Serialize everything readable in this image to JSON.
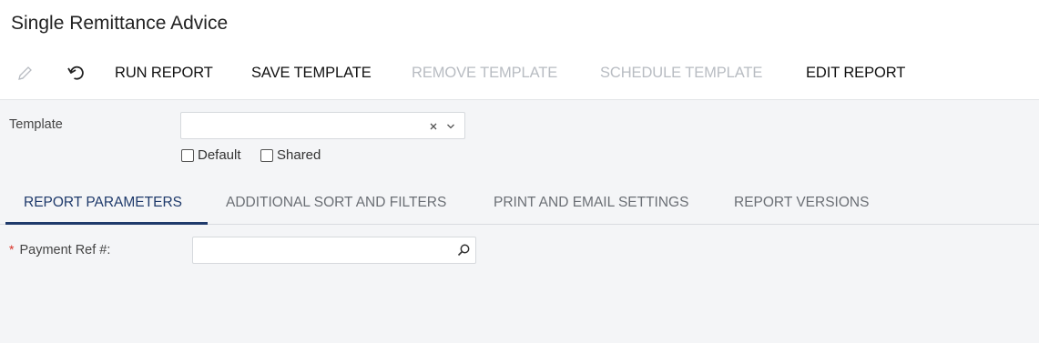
{
  "page": {
    "title": "Single Remittance Advice"
  },
  "toolbar": {
    "run_report": "RUN REPORT",
    "save_template": "SAVE TEMPLATE",
    "remove_template": "REMOVE TEMPLATE",
    "schedule_template": "SCHEDULE TEMPLATE",
    "edit_report": "EDIT REPORT",
    "icons": {
      "edit": "pencil-icon",
      "undo": "undo-icon"
    }
  },
  "template_section": {
    "label": "Template",
    "value": "",
    "default_label": "Default",
    "shared_label": "Shared",
    "default_checked": false,
    "shared_checked": false
  },
  "tabs": [
    {
      "label": "REPORT PARAMETERS",
      "active": true
    },
    {
      "label": "ADDITIONAL SORT AND FILTERS",
      "active": false
    },
    {
      "label": "PRINT AND EMAIL SETTINGS",
      "active": false
    },
    {
      "label": "REPORT VERSIONS",
      "active": false
    }
  ],
  "parameters": {
    "payment_ref": {
      "label": "Payment Ref #:",
      "required_marker": "*",
      "value": ""
    }
  },
  "colors": {
    "accent": "#1f3a6b",
    "required": "#d93025",
    "disabled": "#b8bcc2"
  }
}
